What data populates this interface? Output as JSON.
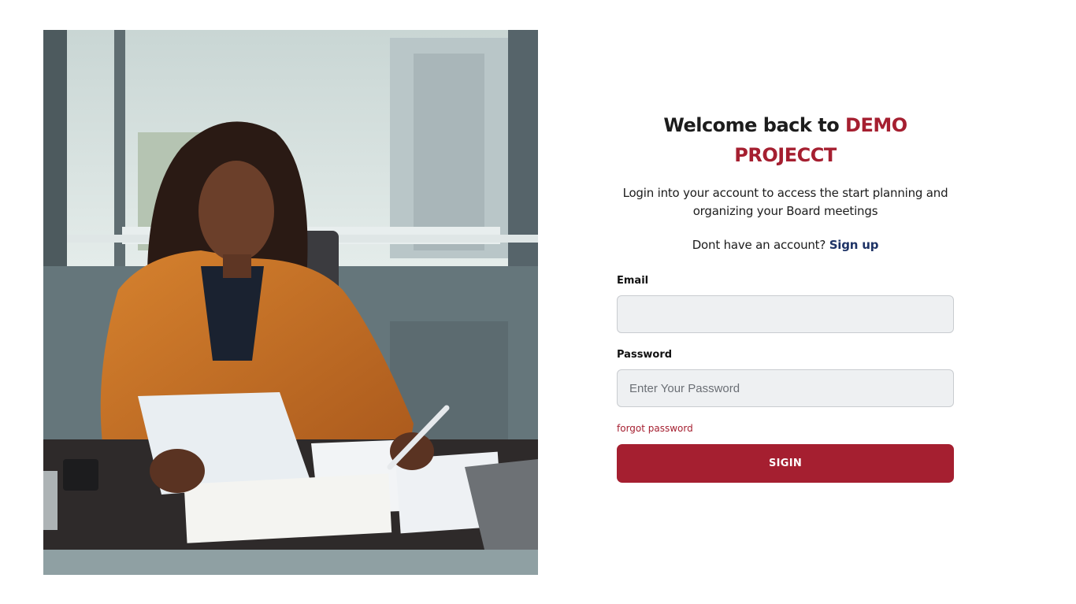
{
  "hero": {
    "image_description": "woman-reviewing-documents-photo"
  },
  "header": {
    "title_prefix": "Welcome back to ",
    "title_brand": "DEMO PROJECCT"
  },
  "intro": {
    "subtitle": "Login into your account to access the start planning and organizing your Board meetings",
    "signup_prompt": "Dont have an account? ",
    "signup_link": "Sign up"
  },
  "form": {
    "email_label": "Email",
    "email_value": "",
    "email_placeholder": "",
    "password_label": "Password",
    "password_value": "",
    "password_placeholder": "Enter Your Password",
    "forgot_link": "forgot password",
    "submit_label": "SIGIN"
  },
  "colors": {
    "brand": "#a51f30",
    "link": "#1e3366",
    "input_bg": "#eef0f2"
  }
}
